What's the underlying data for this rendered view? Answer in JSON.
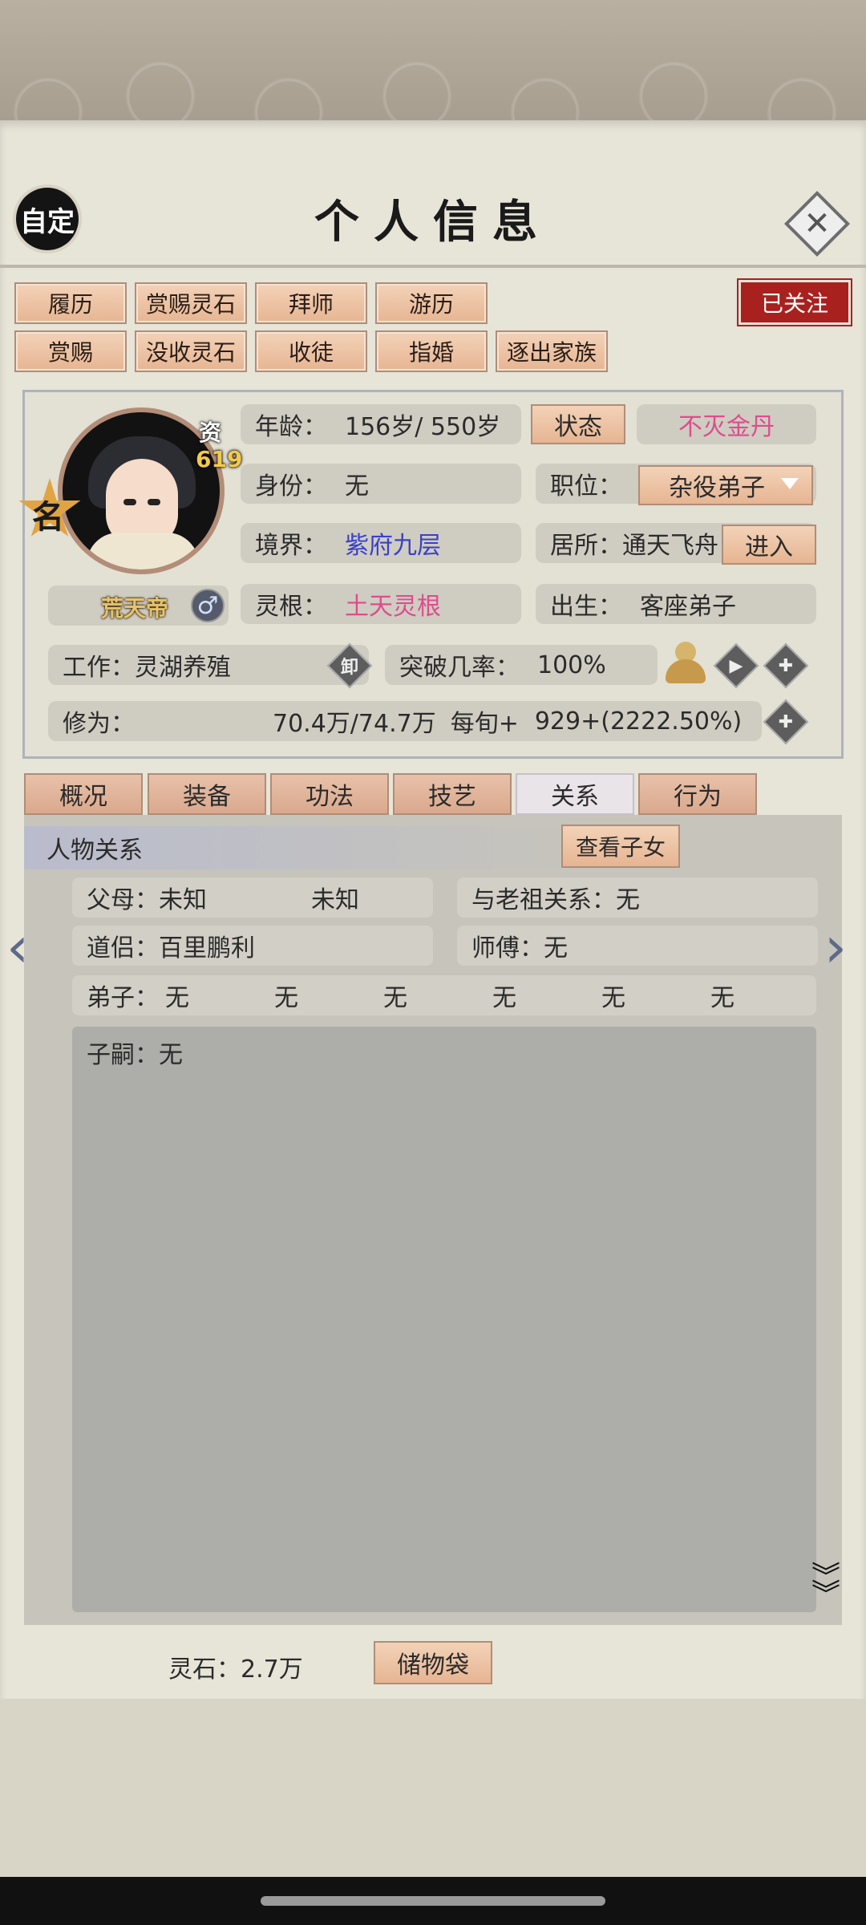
{
  "header": {
    "auto_label": "自定",
    "title": "个人信息"
  },
  "actions": {
    "row1": [
      "履历",
      "赏赐灵石",
      "拜师",
      "游历"
    ],
    "row2": [
      "赏赐",
      "没收灵石",
      "收徒",
      "指婚",
      "逐出家族"
    ],
    "followed_label": "已关注"
  },
  "profile": {
    "zi_label": "资",
    "zi_value": "619",
    "star_label": "名",
    "title_name": "荒天帝",
    "age_label": "年龄：",
    "age_value": "156岁/ 550岁",
    "status_button": "状态",
    "status_value": "不灭金丹",
    "identity_label": "身份：",
    "identity_value": "无",
    "position_label": "职位：",
    "position_value": "杂役弟子",
    "realm_label": "境界：",
    "realm_value": "紫府九层",
    "residence_label": "居所：",
    "residence_value": "通天飞舟",
    "enter_button": "进入",
    "root_label": "灵根：",
    "root_value": "土天灵根",
    "birth_label": "出生：",
    "birth_value": "客座弟子",
    "work_label": "工作：",
    "work_value": "灵湖养殖",
    "unload_icon_label": "卸",
    "breakthrough_label": "突破几率：",
    "breakthrough_value": "100%",
    "cultivation_label": "修为：",
    "cultivation_value": "70.4万/74.7万",
    "per_turn_label": "每旬+",
    "per_turn_value": "929+(2222.50%)"
  },
  "tabs": [
    "概况",
    "装备",
    "功法",
    "技艺",
    "关系",
    "行为"
  ],
  "relations": {
    "section_title": "人物关系",
    "view_children_button": "查看子女",
    "parents_label": "父母：",
    "parent1": "未知",
    "parent2": "未知",
    "ancestor_label": "与老祖关系：",
    "ancestor_value": "无",
    "partner_label": "道侣：",
    "partner_value": "百里鹏利",
    "master_label": "师傅：",
    "master_value": "无",
    "disciples_label": "弟子：",
    "disciples": [
      "无",
      "无",
      "无",
      "无",
      "无",
      "无"
    ],
    "heirs_label": "子嗣：",
    "heirs_value": "无"
  },
  "footer": {
    "stone_label": "灵石：",
    "stone_value": "2.7万",
    "bag_button": "储物袋"
  },
  "colors": {
    "accent_blue": "#3a41c8",
    "accent_pink": "#de4c8c",
    "followed_red": "#a8211e"
  }
}
